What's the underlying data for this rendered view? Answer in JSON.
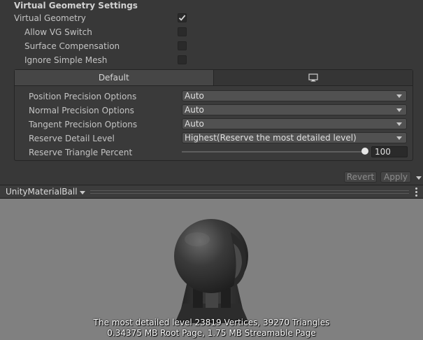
{
  "section": {
    "title": "Virtual Geometry Settings"
  },
  "options": [
    {
      "label": "Virtual Geometry",
      "checked": true
    },
    {
      "label": "Allow VG Switch",
      "checked": false
    },
    {
      "label": "Surface Compensation",
      "checked": false
    },
    {
      "label": "Ignore Simple Mesh",
      "checked": false
    }
  ],
  "platform_tabs": [
    {
      "label": "Default",
      "active": true
    },
    {
      "label": "",
      "icon": "monitor-icon",
      "active": false
    }
  ],
  "settings": [
    {
      "label": "Position Precision Options",
      "value": "Auto"
    },
    {
      "label": "Normal Precision Options",
      "value": "Auto"
    },
    {
      "label": "Tangent Precision Options",
      "value": "Auto"
    },
    {
      "label": "Reserve Detail Level",
      "value": "Highest(Reserve the most detailed level)"
    }
  ],
  "reserve_triangle": {
    "label": "Reserve Triangle Percent",
    "value": "100",
    "percent": 100
  },
  "buttons": {
    "revert": "Revert",
    "apply": "Apply"
  },
  "preview": {
    "name": "UnityMaterialBall",
    "stats_line1": "The most detailed level 23819 Vertices, 39270 Triangles",
    "stats_line2": "0.34375 MB Root Page, 1.75 MB Streamable Page"
  },
  "colors": {
    "panel": "#383838",
    "viewport": "#808080",
    "check": "#d6d6d6"
  }
}
